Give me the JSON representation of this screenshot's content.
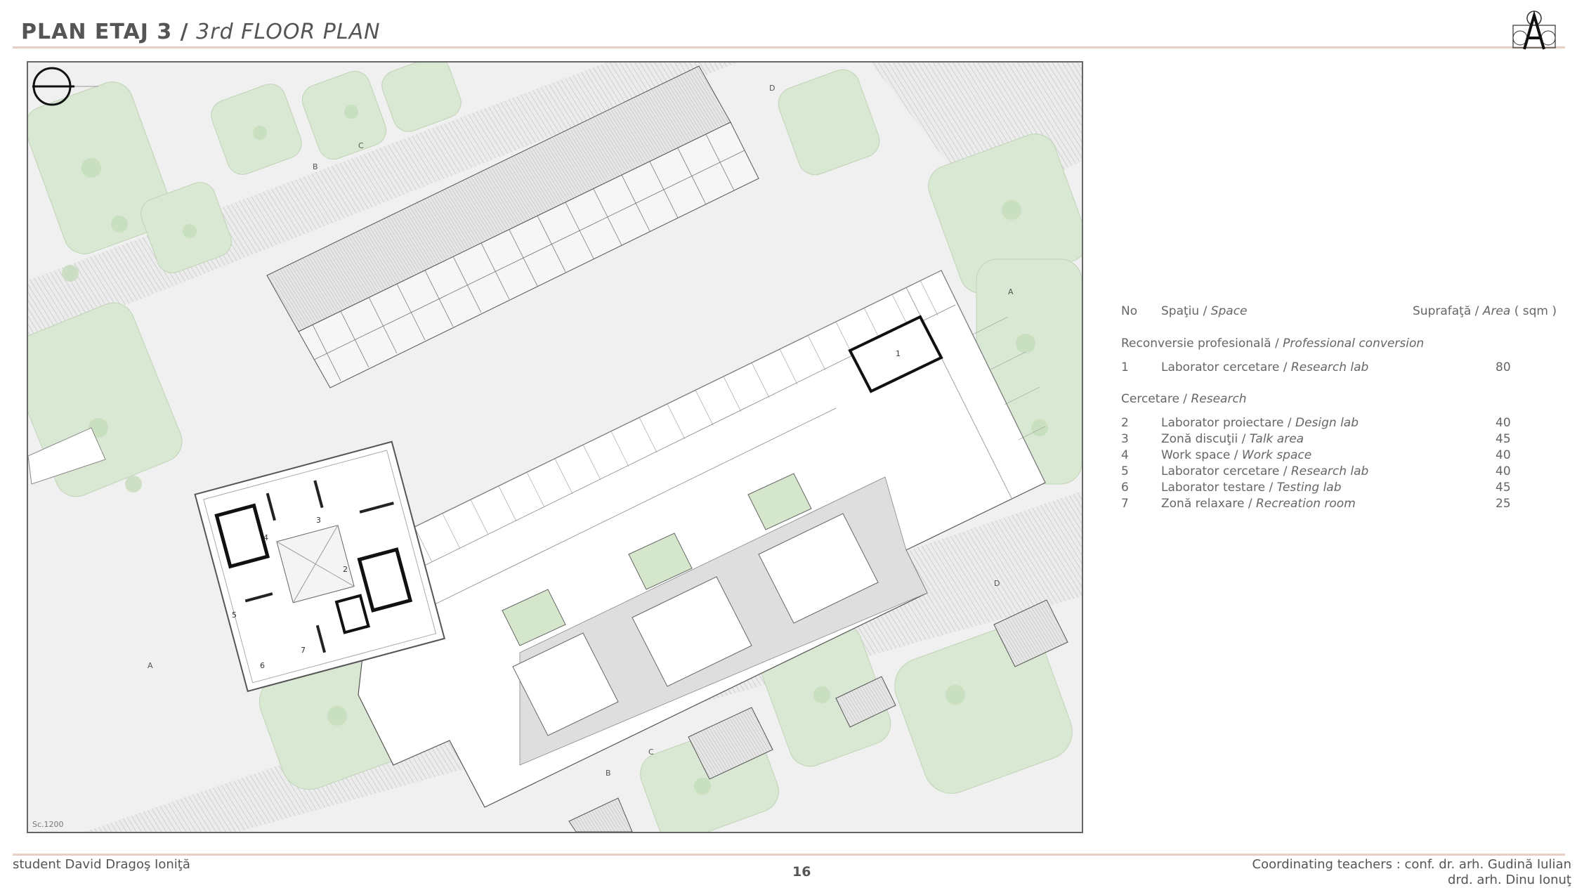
{
  "header": {
    "title_ro": "PLAN ETAJ 3 /",
    "title_en": "3rd FLOOR PLAN"
  },
  "plan": {
    "scale_label": "Sc.1200",
    "room_numbers": [
      "1",
      "2",
      "3",
      "4",
      "5",
      "6",
      "7"
    ],
    "section_marks": [
      "A",
      "A",
      "B",
      "B",
      "C",
      "C",
      "D",
      "D"
    ]
  },
  "legend": {
    "col_no": "No",
    "col_space_ro": "Spaţiu /",
    "col_space_en": "Space",
    "col_area_ro": "Suprafaţă /",
    "col_area_en": "Area",
    "col_area_unit": "( sqm )",
    "groups": [
      {
        "name_ro": "Reconversie profesională /",
        "name_en": "Professional conversion",
        "rows": [
          {
            "no": "1",
            "ro": "Laborator cercetare /",
            "en": "Research lab",
            "area": "80"
          }
        ]
      },
      {
        "name_ro": "Cercetare /",
        "name_en": "Research",
        "rows": [
          {
            "no": "2",
            "ro": "Laborator proiectare /",
            "en": "Design lab",
            "area": "40"
          },
          {
            "no": "3",
            "ro": "Zonă discuţii /",
            "en": "Talk area",
            "area": "45"
          },
          {
            "no": "4",
            "ro": "Work space /",
            "en": "Work space",
            "area": "40"
          },
          {
            "no": "5",
            "ro": "Laborator cercetare /",
            "en": "Research lab",
            "area": "40"
          },
          {
            "no": "6",
            "ro": "Laborator testare /",
            "en": "Testing lab",
            "area": "45"
          },
          {
            "no": "7",
            "ro": "Zonă relaxare /",
            "en": "Recreation room",
            "area": "25"
          }
        ]
      }
    ]
  },
  "footer": {
    "student": "student David Dragoş Ioniţă",
    "page": "16",
    "teachers_line1": "Coordinating teachers : conf. dr. arh. Gudină Iulian",
    "teachers_line2": "drd. arh. Dinu Ionuţ"
  },
  "colors": {
    "accent_rule": "#e7cfc5",
    "text": "#555555",
    "vegetation": "#cfe3c8"
  }
}
